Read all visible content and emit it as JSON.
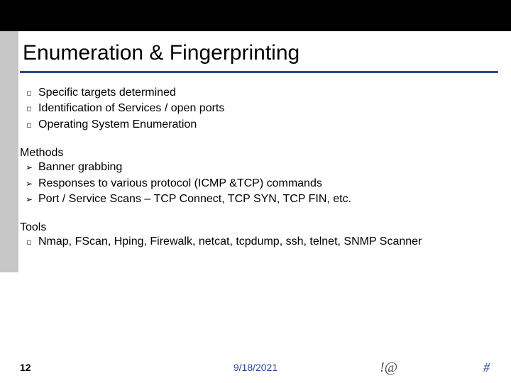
{
  "title": "Enumeration & Fingerprinting",
  "section1": {
    "items": [
      "Specific targets determined",
      "Identification of Services / open ports",
      "Operating System Enumeration"
    ]
  },
  "section2": {
    "label": "Methods",
    "items": [
      "Banner grabbing",
      "Responses to various protocol (ICMP &TCP) commands",
      "Port / Service Scans – TCP Connect, TCP SYN, TCP FIN, etc."
    ]
  },
  "section3": {
    "label": "Tools",
    "items": [
      "Nmap, FScan, Hping, Firewalk, netcat, tcpdump, ssh, telnet, SNMP Scanner"
    ]
  },
  "footer": {
    "slide_number": "12",
    "date": "9/18/2021",
    "symbol1": "!@",
    "symbol2": "#"
  }
}
